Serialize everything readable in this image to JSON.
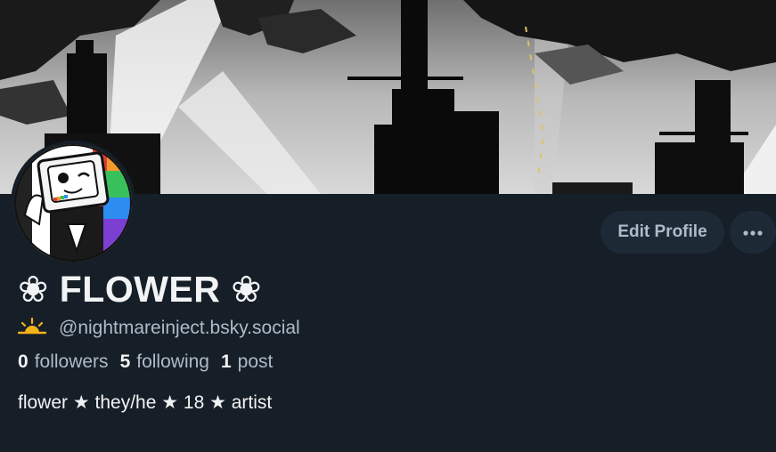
{
  "profile": {
    "display_name": "❀ FLOWER ❀",
    "handle": "@nightmareinject.bsky.social",
    "handle_icon": "sunrise-icon",
    "followers_count": "0",
    "followers_label": "followers",
    "following_count": "5",
    "following_label": "following",
    "posts_count": "1",
    "posts_label": "post",
    "bio": "flower ★ they/he ★ 18 ★ artist"
  },
  "actions": {
    "edit_label": "Edit Profile",
    "more_icon": "more-horizontal-icon"
  },
  "colors": {
    "background": "#161e27",
    "button": "#1e2936",
    "muted_text": "#aebbc9",
    "text": "#f1f3f5"
  }
}
